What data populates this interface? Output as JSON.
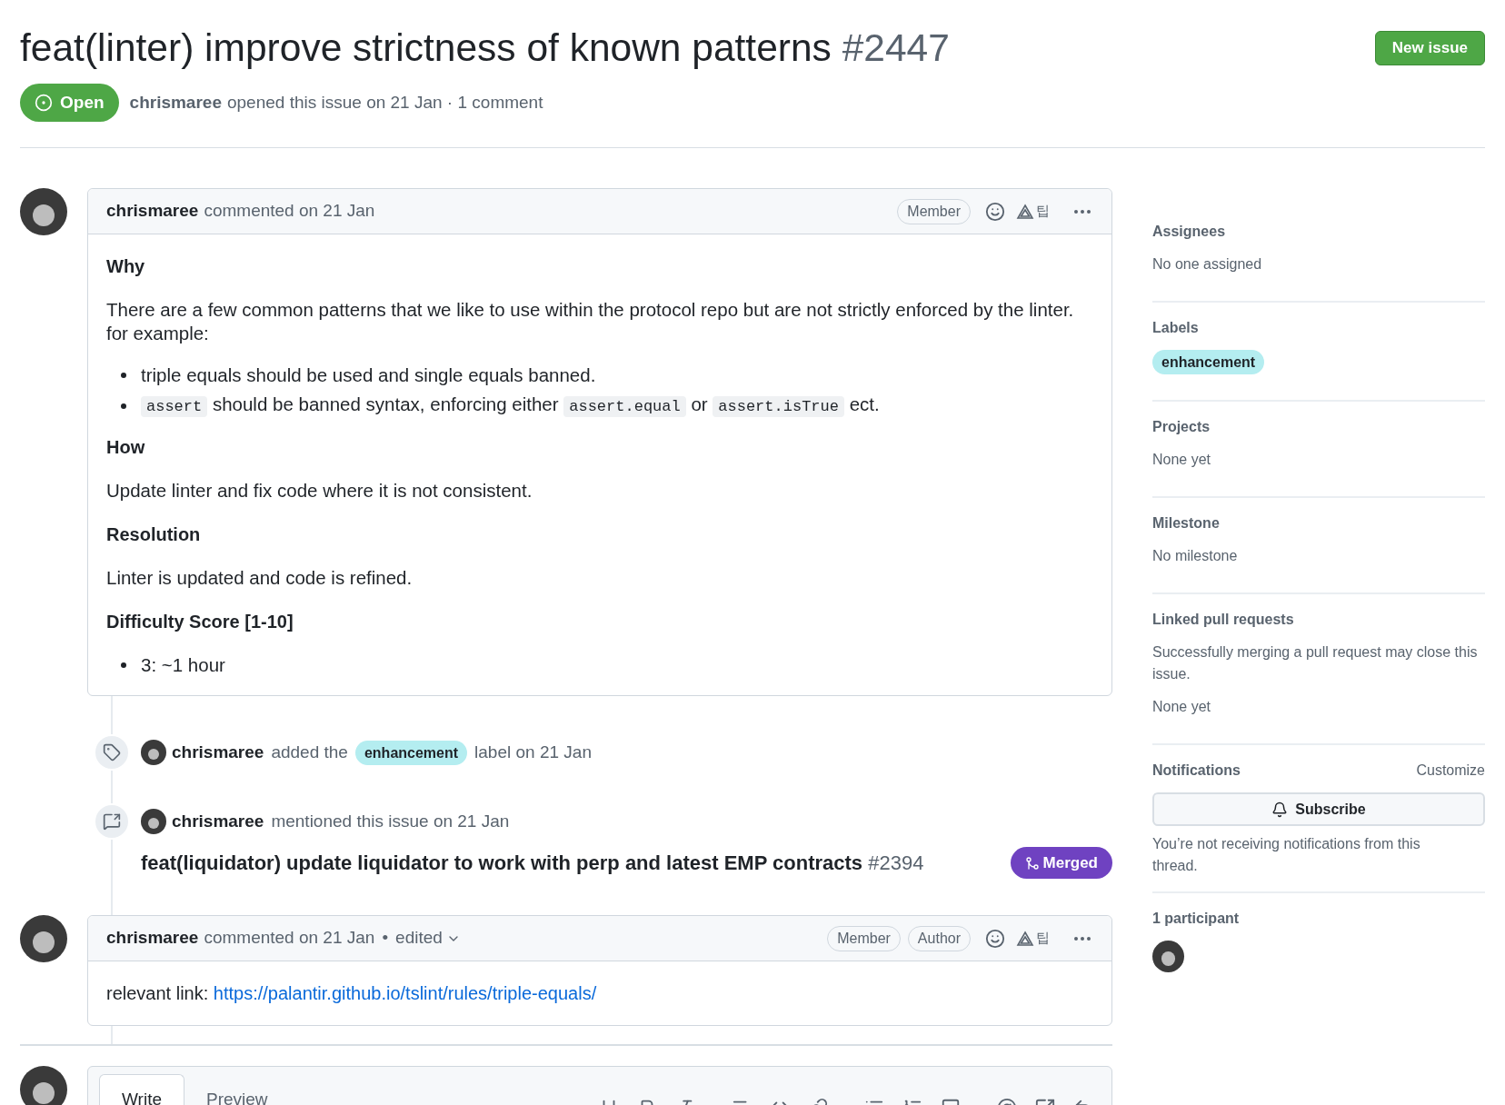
{
  "header": {
    "title": "feat(linter) improve strictness of known patterns",
    "number": "#2447",
    "new_issue": "New issue",
    "state": {
      "label": "Open",
      "kind": "open"
    },
    "author": "chrismaree",
    "meta": "opened this issue on 21 Jan · 1 comment"
  },
  "comments": [
    {
      "author": "chrismaree",
      "meta": "commented on 21 Jan",
      "badges": [
        "Member"
      ],
      "ext_label": "팁",
      "body": [
        {
          "kind": "heading",
          "text": "Why"
        },
        {
          "kind": "paragraph",
          "text": "There are a few common patterns that we like to use within the protocol repo but are not strictly enforced by the linter.\nfor example:"
        },
        {
          "kind": "list",
          "items": [
            [
              {
                "text": "triple equals should be used and single equals banned.",
                "code": false
              }
            ],
            [
              {
                "text": "assert",
                "code": true
              },
              {
                "text": " should be banned syntax, enforcing either ",
                "code": false
              },
              {
                "text": "assert.equal",
                "code": true
              },
              {
                "text": " or ",
                "code": false
              },
              {
                "text": "assert.isTrue",
                "code": true
              },
              {
                "text": " ect.",
                "code": false
              }
            ]
          ]
        },
        {
          "kind": "heading",
          "text": "How"
        },
        {
          "kind": "paragraph",
          "text": "Update linter and fix code where it is not consistent."
        },
        {
          "kind": "heading",
          "text": "Resolution"
        },
        {
          "kind": "paragraph",
          "text": "Linter is updated and code is refined."
        },
        {
          "kind": "heading",
          "text": "Difficulty Score [1-10]"
        },
        {
          "kind": "list",
          "items": [
            [
              {
                "text": "3: ~1 hour",
                "code": false
              }
            ]
          ]
        }
      ]
    }
  ],
  "events": [
    {
      "kind": "label",
      "author": "chrismaree",
      "before": "added the",
      "label": "enhancement",
      "after": "label on 21 Jan"
    },
    {
      "kind": "mention",
      "author": "chrismaree",
      "before": "mentioned this issue on 21 Jan",
      "pr_title": "feat(liquidator) update liquidator to work with perp and latest EMP contracts",
      "pr_number": "#2394",
      "pr_state": "Merged"
    }
  ],
  "second_comment": {
    "author": "chrismaree",
    "meta": "commented on 21 Jan",
    "separator": "•",
    "edited": "edited",
    "badges": [
      "Member",
      "Author"
    ],
    "ext_label": "팁",
    "link_prefix": "relevant link:",
    "link": "https://palantir.github.io/tslint/rules/triple-equals/"
  },
  "editor": {
    "tabs": [
      {
        "label": "Write",
        "selected": true
      },
      {
        "label": "Preview",
        "selected": false
      }
    ]
  },
  "sidebar": {
    "sections": [
      {
        "kind": "text",
        "title": "Assignees",
        "lines": [
          "No one assigned"
        ]
      },
      {
        "kind": "labels",
        "title": "Labels",
        "labels": [
          {
            "text": "enhancement",
            "color": "#b4edf0"
          }
        ]
      },
      {
        "kind": "text",
        "title": "Projects",
        "lines": [
          "None yet"
        ]
      },
      {
        "kind": "text",
        "title": "Milestone",
        "lines": [
          "No milestone"
        ]
      },
      {
        "kind": "text",
        "title": "Linked pull requests",
        "lines": [
          "Successfully merging a pull request may close this issue.",
          "None yet"
        ]
      },
      {
        "kind": "notifications",
        "title": "Notifications",
        "action": "Customize",
        "button": "Subscribe",
        "note": "You’re not receiving notifications from this thread."
      },
      {
        "kind": "participants",
        "title": "1 participant"
      }
    ]
  }
}
